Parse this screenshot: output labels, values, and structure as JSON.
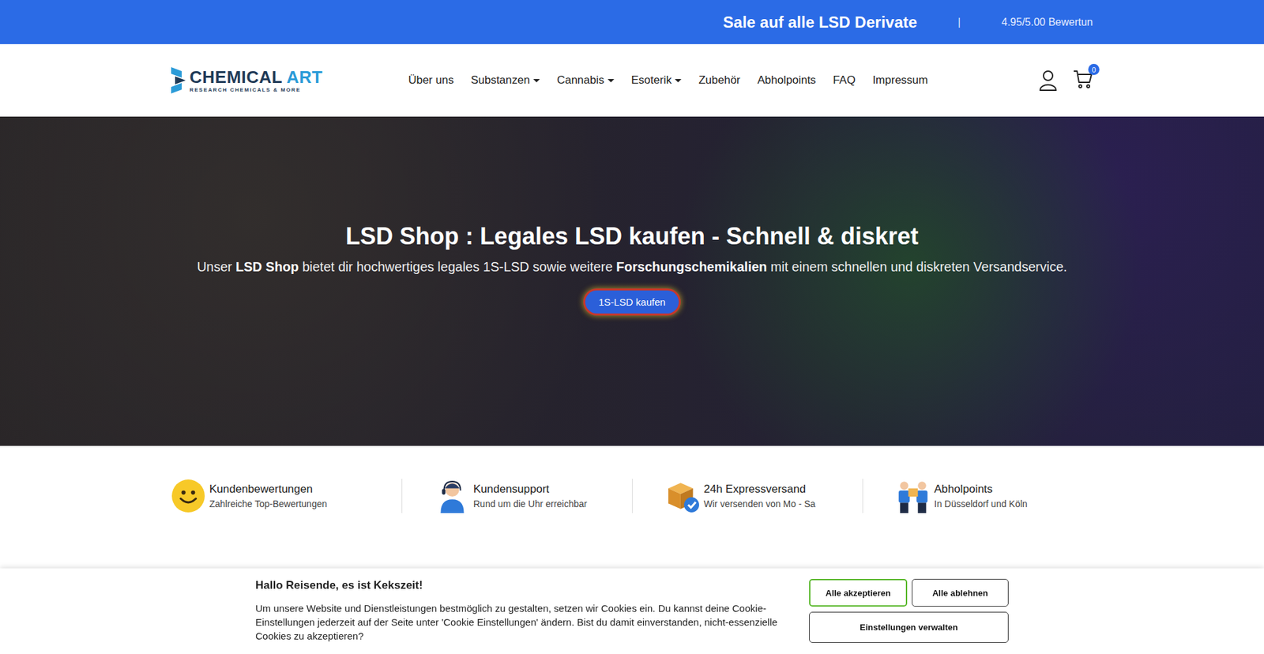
{
  "topbar": {
    "sale": "Sale auf alle LSD Derivate",
    "separator": "|",
    "rating": "4.95/5.00 Bewertun"
  },
  "logo": {
    "word1": "CHEMICAL",
    "word2": "ART",
    "tagline": "RESEARCH CHEMICALS & MORE"
  },
  "nav": [
    {
      "label": "Über uns",
      "dropdown": false
    },
    {
      "label": "Substanzen",
      "dropdown": true
    },
    {
      "label": "Cannabis",
      "dropdown": true
    },
    {
      "label": "Esoterik",
      "dropdown": true
    },
    {
      "label": "Zubehör",
      "dropdown": false
    },
    {
      "label": "Abholpoints",
      "dropdown": false
    },
    {
      "label": "FAQ",
      "dropdown": false
    },
    {
      "label": "Impressum",
      "dropdown": false
    }
  ],
  "cart": {
    "count": "0"
  },
  "hero": {
    "title": "LSD Shop : Legales LSD kaufen - Schnell & diskret",
    "subtitle": [
      {
        "text": "Unser ",
        "bold": false
      },
      {
        "text": "LSD Shop",
        "bold": true
      },
      {
        "text": " bietet dir hochwertiges legales 1S-LSD sowie weitere ",
        "bold": false
      },
      {
        "text": "Forschungschemikalien",
        "bold": true
      },
      {
        "text": " mit einem schnellen und diskreten Versandservice.",
        "bold": false
      }
    ],
    "button": "1S-LSD kaufen"
  },
  "features": [
    {
      "kind": "smiley",
      "title": "Kundenbewertungen",
      "text": "Zahlreiche Top-Bewertungen"
    },
    {
      "kind": "support",
      "title": "Kundensupport",
      "text": "Rund um die Uhr erreichbar"
    },
    {
      "kind": "box",
      "title": "24h Expressversand",
      "text": "Wir versenden von Mo - Sa"
    },
    {
      "kind": "pickup",
      "title": "Abholpoints",
      "text": "In Düsseldorf und Köln"
    }
  ],
  "cookie": {
    "title": "Hallo Reisende, es ist Kekszeit!",
    "text": "Um unsere Website und Dienstleistungen bestmöglich zu gestalten, setzen wir Cookies ein. Du kannst deine Cookie-Einstellungen jederzeit auf der Seite unter 'Cookie Einstellungen' ändern. Bist du damit einverstanden, nicht-essenzielle Cookies zu akzeptieren?",
    "buttons": [
      {
        "label": "Alle akzeptieren",
        "primary": true
      },
      {
        "label": "Alle ablehnen",
        "primary": false
      }
    ],
    "manage": "Einstellungen verwalten"
  }
}
